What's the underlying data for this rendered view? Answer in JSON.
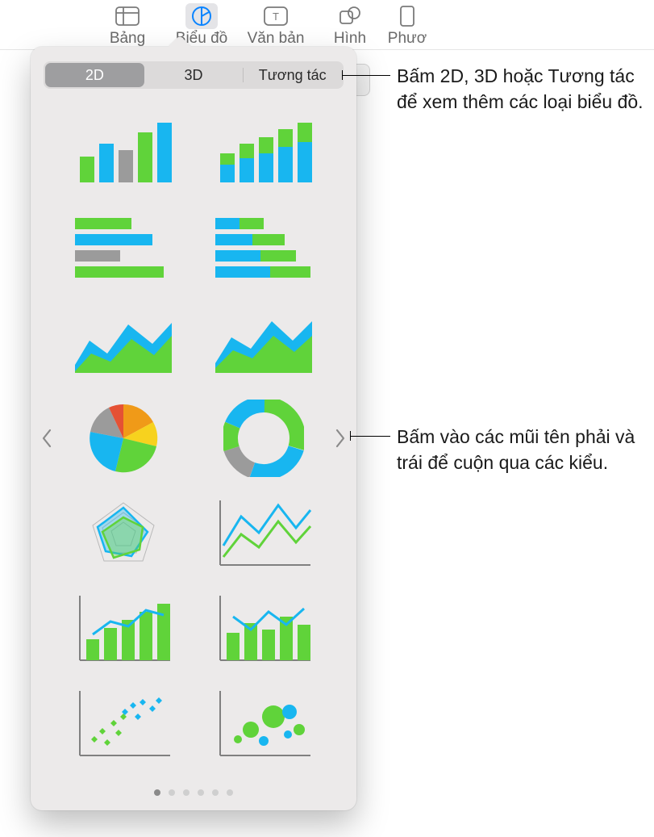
{
  "toolbar": {
    "items": [
      {
        "label": "Bảng"
      },
      {
        "label": "Biểu đồ"
      },
      {
        "label": "Văn bản"
      },
      {
        "label": "Hình"
      },
      {
        "label": "Phươ"
      }
    ]
  },
  "popover": {
    "tabs": {
      "twod": "2D",
      "threed": "3D",
      "interactive": "Tương tác"
    },
    "page_count": 6,
    "active_page": 0
  },
  "callouts": {
    "tabs": "Bấm 2D, 3D hoặc Tương tác để xem thêm các loại biểu đồ.",
    "arrows": "Bấm vào các mũi tên phải và trái để cuộn qua các kiểu."
  },
  "colors": {
    "green": "#60d33a",
    "blue": "#18b6f0",
    "gray": "#9b9b9b",
    "orange": "#f09a18",
    "yellow": "#f7d21e",
    "red": "#e55134",
    "axis": "#808080"
  }
}
